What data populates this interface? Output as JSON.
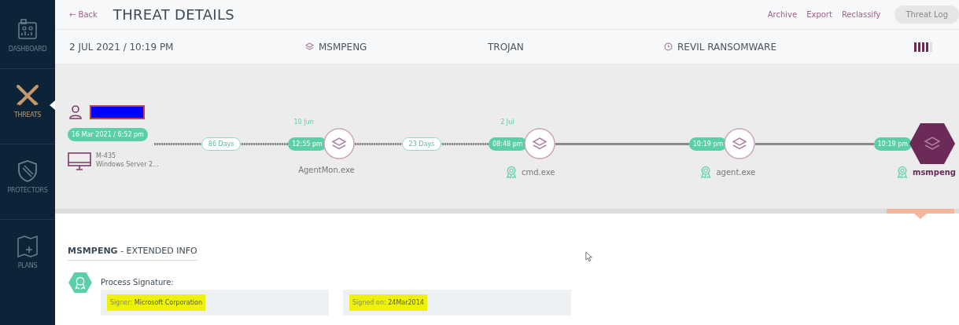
{
  "sidebar": {
    "items": [
      {
        "label": "DASHBOARD",
        "kind": "dashboard",
        "selected": false
      },
      {
        "label": "THREATS",
        "kind": "threats",
        "selected": true
      },
      {
        "label": "PROTECTORS",
        "kind": "protectors",
        "selected": false
      },
      {
        "label": "PLANS",
        "kind": "plans",
        "selected": false
      }
    ]
  },
  "header": {
    "back": "← Back",
    "title": "THREAT DETAILS",
    "actions": [
      {
        "label": "Archive",
        "kind": "link"
      },
      {
        "label": "Export",
        "kind": "link"
      },
      {
        "label": "Reclassify",
        "kind": "link"
      },
      {
        "label": "Threat Log",
        "kind": "pill"
      }
    ]
  },
  "summary": {
    "date": "2 JUL 2021 / 10:19 PM",
    "process": "MSMPENG",
    "type": "TROJAN",
    "family": "REVIL RANSOMWARE",
    "severity": {
      "level": 0.8
    }
  },
  "timeline": {
    "source": {
      "user_redacted": true,
      "start": "16 Mar 2021 / 6:52 pm",
      "machine": "M-435",
      "os": "Windows Server 2..."
    },
    "steps": [
      {
        "gap": "86 Days",
        "dashed": true,
        "date": "10 Jun",
        "time": "12:55 pm",
        "name": "AgentMon.exe",
        "signed": false,
        "selected": false
      },
      {
        "gap": "23 Days",
        "dashed": true,
        "date": "2 Jul",
        "time": "08:48 pm",
        "name": "cmd.exe",
        "signed": true,
        "selected": false
      },
      {
        "dashed": false,
        "time": "10:19 pm",
        "name": "agent.exe",
        "signed": true,
        "selected": false
      },
      {
        "dashed": false,
        "time": "10:19 pm",
        "name": "msmpeng",
        "signed": true,
        "selected": true
      }
    ]
  },
  "extended": {
    "title": "**MSMPENG** - EXTENDED INFO",
    "signature": {
      "label": "Process Signature:",
      "fields": [
        {
          "label": "Signer:",
          "value": "Microsoft Corporation",
          "highlighted": true
        },
        {
          "label": "Signed on:",
          "value": "24Mar2014",
          "highlighted": true
        }
      ]
    }
  }
}
